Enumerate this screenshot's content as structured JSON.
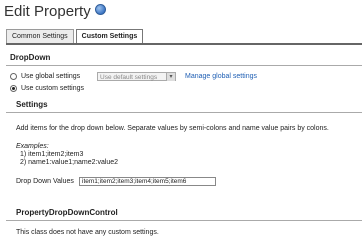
{
  "header": {
    "title": "Edit Property"
  },
  "tabs": [
    {
      "label": "Common Settings"
    },
    {
      "label": "Custom Settings"
    }
  ],
  "dropdown_section": {
    "heading": "DropDown",
    "use_global_label": "Use global settings",
    "global_select_value": "Use default settings",
    "manage_link": "Manage global settings",
    "use_custom_label": "Use custom settings",
    "selected_option": "Use custom settings"
  },
  "settings_section": {
    "heading": "Settings",
    "instructions": "Add items for the drop down below. Separate values by semi-colons and name value pairs by colons.",
    "examples_label": "Examples:",
    "example_1": "1) item1;item2;item3",
    "example_2": "2) name1:value1;name2:value2",
    "values_label": "Drop Down Values",
    "values_input": "item1;item2;item3;item4;item5;item6"
  },
  "control_section": {
    "heading": "PropertyDropDownControl",
    "message": "This class does not have any custom settings."
  }
}
